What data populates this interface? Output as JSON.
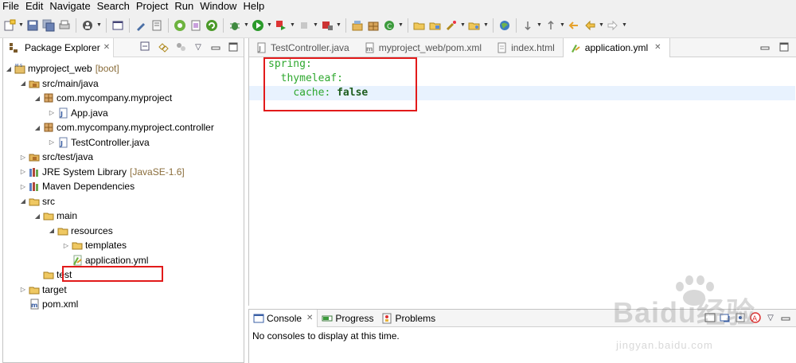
{
  "menu": [
    "File",
    "Edit",
    "Navigate",
    "Search",
    "Project",
    "Run",
    "Window",
    "Help"
  ],
  "package_explorer": {
    "title": "Package Explorer",
    "tree": [
      {
        "label": "myproject_web",
        "decor": "[boot]",
        "icon": "project-icon",
        "twisty": "expanded"
      },
      {
        "label": "src/main/java",
        "icon": "source-folder-icon",
        "twisty": "expanded"
      },
      {
        "label": "com.mycompany.myproject",
        "icon": "package-icon",
        "twisty": "expanded"
      },
      {
        "label": "App.java",
        "icon": "java-file-icon",
        "twisty": "collapsed"
      },
      {
        "label": "com.mycompany.myproject.controller",
        "icon": "package-icon",
        "twisty": "expanded"
      },
      {
        "label": "TestController.java",
        "icon": "java-file-icon",
        "twisty": "collapsed"
      },
      {
        "label": "src/test/java",
        "icon": "source-folder-icon",
        "twisty": "collapsed"
      },
      {
        "label": "JRE System Library",
        "decor": "[JavaSE-1.6]",
        "icon": "library-icon",
        "twisty": "collapsed"
      },
      {
        "label": "Maven Dependencies",
        "icon": "library-icon",
        "twisty": "collapsed"
      },
      {
        "label": "src",
        "icon": "folder-icon",
        "twisty": "expanded"
      },
      {
        "label": "main",
        "icon": "folder-icon",
        "twisty": "expanded"
      },
      {
        "label": "resources",
        "icon": "folder-icon",
        "twisty": "expanded"
      },
      {
        "label": "templates",
        "icon": "folder-icon",
        "twisty": "collapsed"
      },
      {
        "label": "application.yml",
        "icon": "yml-file-icon",
        "twisty": "none"
      },
      {
        "label": "test",
        "icon": "folder-icon",
        "twisty": "none"
      },
      {
        "label": "target",
        "icon": "folder-icon",
        "twisty": "collapsed"
      },
      {
        "label": "pom.xml",
        "icon": "xml-file-icon",
        "twisty": "none"
      }
    ]
  },
  "editor": {
    "tabs": [
      {
        "label": "TestController.java",
        "icon": "java-file-icon",
        "active": false
      },
      {
        "label": "myproject_web/pom.xml",
        "icon": "xml-file-icon",
        "active": false
      },
      {
        "label": "index.html",
        "icon": "html-file-icon",
        "active": false
      },
      {
        "label": "application.yml",
        "icon": "yml-file-icon",
        "active": true
      }
    ],
    "code": {
      "line1_key": "spring:",
      "line2_key": "thymeleaf:",
      "line3_key": "cache:",
      "line3_value": "false"
    }
  },
  "console": {
    "tabs": [
      {
        "label": "Console",
        "icon": "console-icon"
      },
      {
        "label": "Progress",
        "icon": "progress-icon"
      },
      {
        "label": "Problems",
        "icon": "problems-icon"
      }
    ],
    "message": "No consoles to display at this time."
  },
  "watermark": {
    "main": "Baidu经验",
    "sub": "jingyan.baidu.com"
  },
  "colors": {
    "highlight": "#e21a1a",
    "yaml_key": "#2fa82f",
    "yaml_value": "#1f5e1f",
    "current_line": "#e8f2fe"
  }
}
